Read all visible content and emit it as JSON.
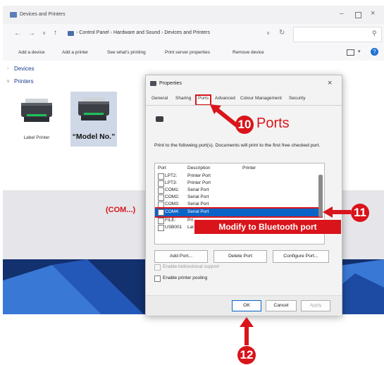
{
  "window": {
    "title": "Devices and Printers",
    "breadcrumb": [
      "Control Panel",
      "Hardware and Sound",
      "Devices and Printers"
    ],
    "commands": [
      "Add a device",
      "Add a printer",
      "See what's printing",
      "Print server properties",
      "Remove device"
    ],
    "sections": {
      "devices": "Devices",
      "printers": "Printers"
    },
    "printers": [
      {
        "label": "Label Printer"
      },
      {
        "label": "“Model No.”"
      }
    ]
  },
  "dialog": {
    "title": "Properties",
    "tabs": [
      "General",
      "Sharing",
      "Ports",
      "Advanced",
      "Colour Management",
      "Security"
    ],
    "instruction": "Print to the following port(s). Documents will print to the first free checked port.",
    "columns": [
      "Port",
      "Description",
      "Printer"
    ],
    "ports": [
      {
        "port": "LPT2:",
        "description": "Printer Port",
        "printer": ""
      },
      {
        "port": "LPT3:",
        "description": "Printer Port",
        "printer": ""
      },
      {
        "port": "COM1:",
        "description": "Serial Port",
        "printer": ""
      },
      {
        "port": "COM2:",
        "description": "Serial Port",
        "printer": ""
      },
      {
        "port": "COM3:",
        "description": "Serial Port",
        "printer": ""
      },
      {
        "port": "COM4:",
        "description": "Serial Port",
        "printer": ""
      },
      {
        "port": "FILE:",
        "description": "Pri",
        "printer": ""
      },
      {
        "port": "USB001",
        "description": "Lal",
        "printer": ""
      }
    ],
    "buttons": {
      "add_port": "Add Port...",
      "delete_port": "Delete Port",
      "configure_port": "Configure Port..."
    },
    "options": {
      "bidirectional": "Enable bidirectional support",
      "pooling": "Enable printer pooling"
    },
    "footer": {
      "ok": "OK",
      "cancel": "Cancel",
      "apply": "Apply"
    }
  },
  "annotations": {
    "step10": {
      "number": "10",
      "label": "Ports"
    },
    "step11": {
      "number": "11",
      "callout": "Modify to Bluetooth port",
      "side_label": "(COM...)"
    },
    "step12": {
      "number": "12"
    },
    "accent": "#d9141b",
    "selection": "#0a64c8"
  }
}
